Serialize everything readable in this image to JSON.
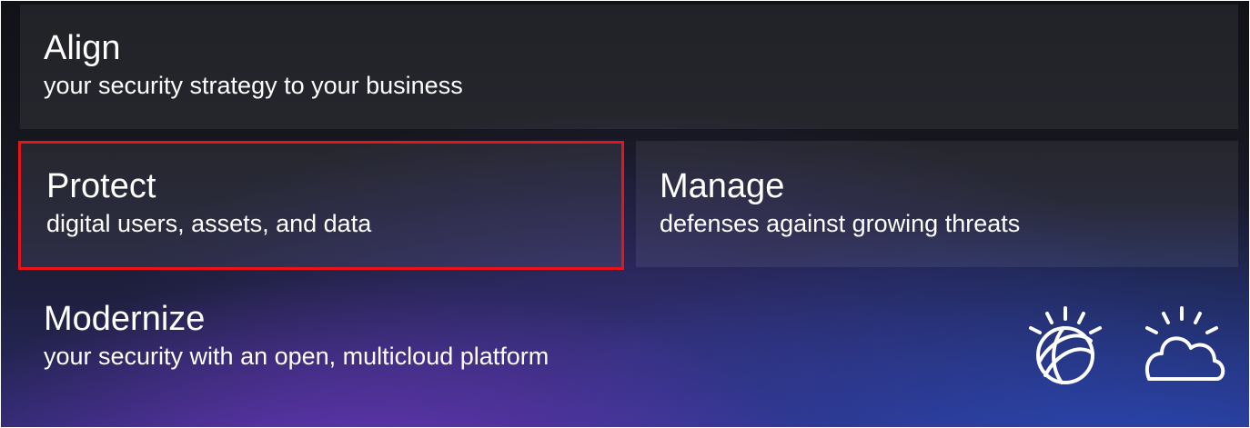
{
  "cards": {
    "align": {
      "title": "Align",
      "subtitle": "your security strategy to your business"
    },
    "protect": {
      "title": "Protect",
      "subtitle": "digital users, assets, and data"
    },
    "manage": {
      "title": "Manage",
      "subtitle": "defenses against growing threats"
    },
    "modernize": {
      "title": "Modernize",
      "subtitle": "your security with an open, multicloud platform"
    }
  },
  "icons": [
    "globe-sunrise-icon",
    "cloud-sunrise-icon"
  ],
  "colors": {
    "highlight_border": "#e8141c",
    "text": "#ffffff"
  }
}
